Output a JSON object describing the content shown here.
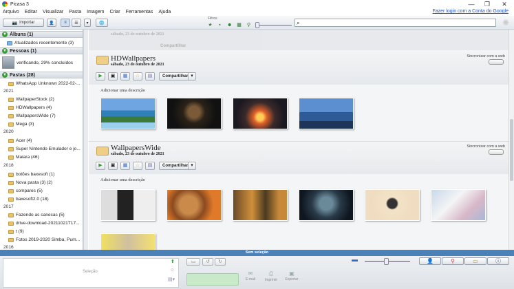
{
  "window": {
    "title": "Picasa 3",
    "controls": [
      "—",
      "❐",
      "✕"
    ]
  },
  "menu": {
    "items": [
      "Arquivo",
      "Editar",
      "Visualizar",
      "Pasta",
      "Imagem",
      "Criar",
      "Ferramentas",
      "Ajuda"
    ],
    "login_link": "Fazer login com a Conta do Google"
  },
  "toolbar": {
    "import_label": "Importar",
    "filters_label": "Filtros",
    "search_value": ""
  },
  "sidebar": {
    "albums_header": "Álbuns (1)",
    "albums_items": [
      "Atualizados recentemente (3)"
    ],
    "people_header": "Pessoas (1)",
    "people_status": "verificando, 29% concluídos",
    "folders_header": "Pastas (28)",
    "folder_groups": [
      {
        "year": "",
        "items": [
          "WhatsApp Unknown 2022-02-..."
        ]
      },
      {
        "year": "2021",
        "items": [
          "WallpaperStock (2)",
          "HDWallpapers (4)",
          "WallpapersWide (7)",
          "Mega (3)"
        ]
      },
      {
        "year": "2020",
        "items": [
          "Acer (4)",
          "Super Nintendo Emulador e jo...",
          "Maiara (46)"
        ]
      },
      {
        "year": "2018",
        "items": [
          "botões baxesoft (1)",
          "Nova pasta (3) (2)",
          "compares (5)",
          "baxesoft2.0 (18)"
        ]
      },
      {
        "year": "2017",
        "items": [
          "Fazendo as canecas (5)",
          "drive-download-20211021T17...",
          "t (9)",
          "Fotos 2019-2020 Simba, Pum..."
        ]
      },
      {
        "year": "2016",
        "items": []
      }
    ]
  },
  "albums": [
    {
      "title": "HDWallpapers",
      "date": "sábado, 23 de outubro de 2021",
      "sync": "Sincronizar com a web",
      "share": "Compartilhar",
      "description_placeholder": "Adicionar uma descrição"
    },
    {
      "title": "WallpapersWide",
      "date": "sábado, 23 de outubro de 2021",
      "sync": "Sincronizar com a web",
      "share": "Compartilhar",
      "description_placeholder": "Adicionar uma descrição"
    }
  ],
  "ghost_album": {
    "date": "sábado, 23 de outubro de 2021",
    "share": "Compartilhar"
  },
  "status": {
    "selection": "Sem seleção"
  },
  "tray": {
    "selection_label": "Seleção",
    "email": "E-mail",
    "print": "Imprimir",
    "export": "Exportar"
  }
}
